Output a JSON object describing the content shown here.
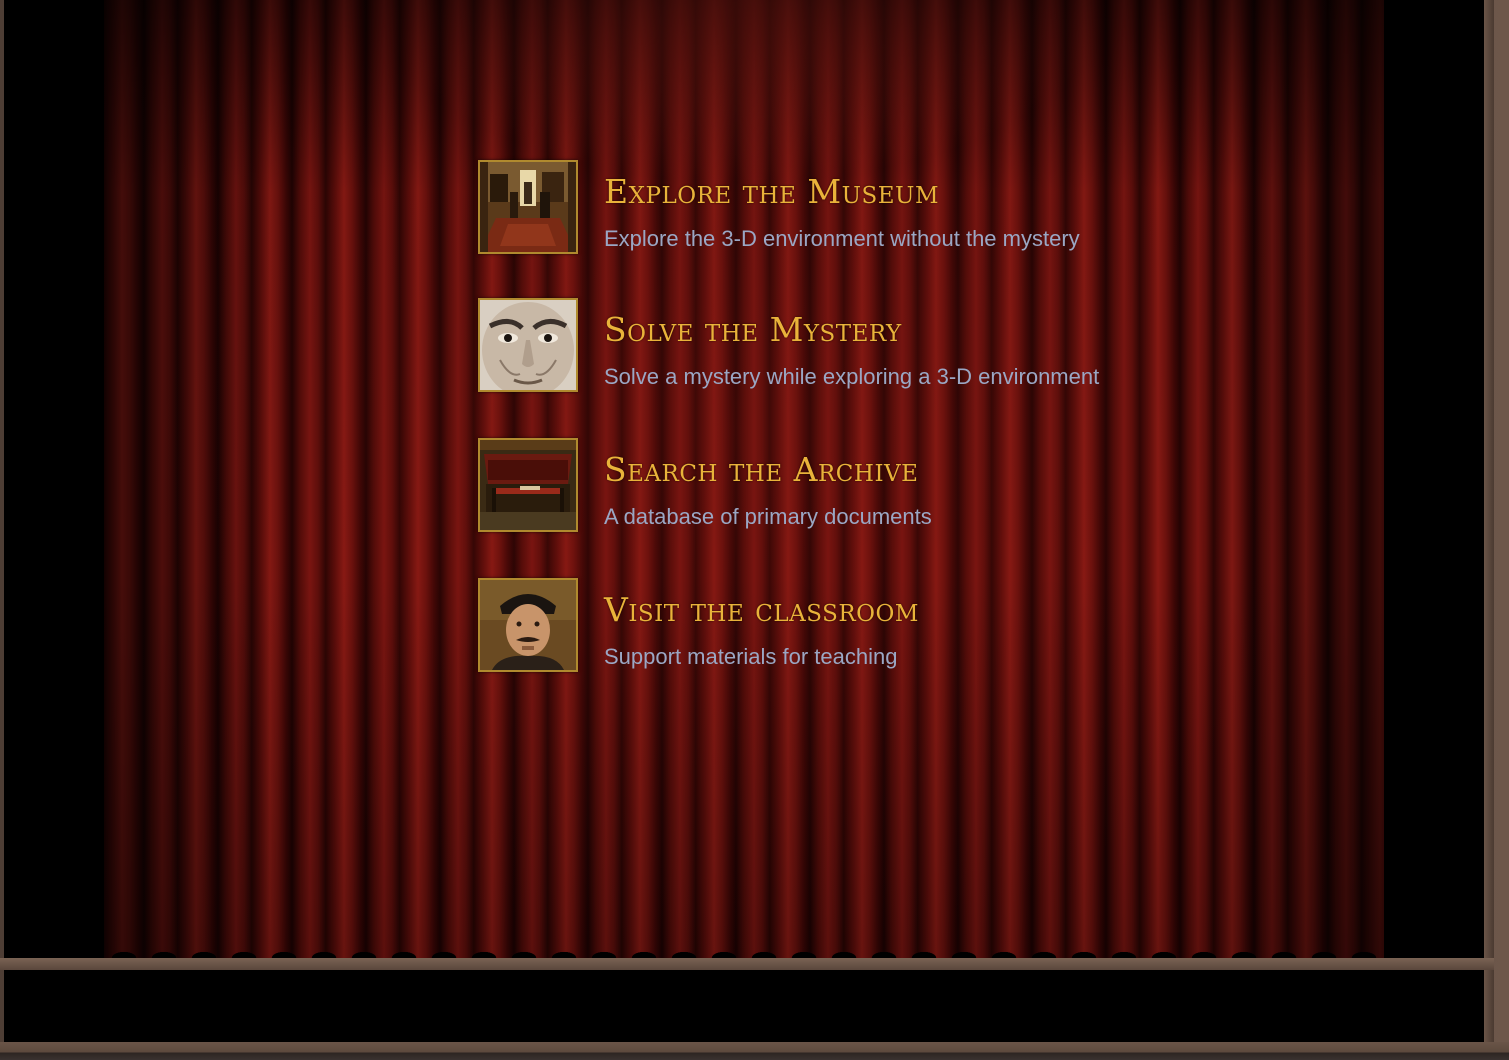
{
  "menu": {
    "items": [
      {
        "title": "Explore the Museum",
        "description": "Explore the 3-D environment without the mystery",
        "thumbnail": "museum-room-thumbnail"
      },
      {
        "title": "Solve the Mystery",
        "description": "Solve a mystery while exploring a 3-D environment",
        "thumbnail": "face-closeup-thumbnail"
      },
      {
        "title": "Search the Archive",
        "description": "A database of primary documents",
        "thumbnail": "archive-drawer-thumbnail"
      },
      {
        "title": "Visit the classroom",
        "description": "Support materials for teaching",
        "thumbnail": "man-portrait-thumbnail"
      }
    ]
  },
  "colors": {
    "title": "#e9b33a",
    "description": "#9aa7c4",
    "curtain": "#6a110d",
    "frame": "#5c4a3f",
    "thumb_border": "#b08a2e"
  }
}
